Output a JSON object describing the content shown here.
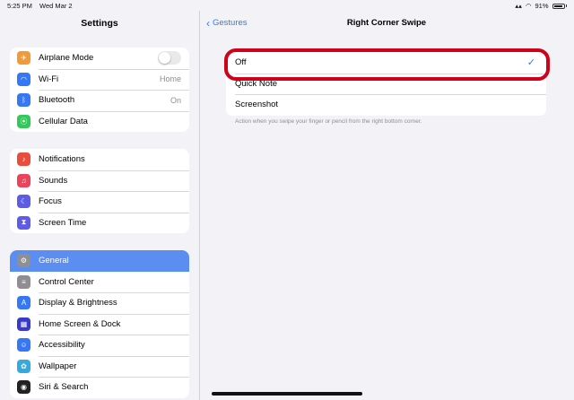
{
  "status": {
    "time": "5:25 PM",
    "date": "Wed Mar 2",
    "battery": "91%"
  },
  "sidebar": {
    "title": "Settings",
    "groups": [
      [
        {
          "label": "Airplane Mode",
          "icon": "airplane-icon",
          "color": "#f19a37",
          "value": "",
          "toggle": true
        },
        {
          "label": "Wi-Fi",
          "icon": "wifi-icon",
          "color": "#3478f6",
          "value": "Home"
        },
        {
          "label": "Bluetooth",
          "icon": "bluetooth-icon",
          "color": "#3478f6",
          "value": "On"
        },
        {
          "label": "Cellular Data",
          "icon": "cellular-icon",
          "color": "#34c759",
          "value": ""
        }
      ],
      [
        {
          "label": "Notifications",
          "icon": "bell-icon",
          "color": "#eb4d3d",
          "value": ""
        },
        {
          "label": "Sounds",
          "icon": "speaker-icon",
          "color": "#eb445a",
          "value": ""
        },
        {
          "label": "Focus",
          "icon": "moon-icon",
          "color": "#5e5ce6",
          "value": ""
        },
        {
          "label": "Screen Time",
          "icon": "hourglass-icon",
          "color": "#5e5ce6",
          "value": ""
        }
      ],
      [
        {
          "label": "General",
          "icon": "gear-icon",
          "color": "#8e8e93",
          "value": "",
          "selected": true
        },
        {
          "label": "Control Center",
          "icon": "sliders-icon",
          "color": "#8e8e93",
          "value": ""
        },
        {
          "label": "Display & Brightness",
          "icon": "text-size-icon",
          "color": "#3478f6",
          "value": ""
        },
        {
          "label": "Home Screen & Dock",
          "icon": "grid-icon",
          "color": "#3a3ac8",
          "value": ""
        },
        {
          "label": "Accessibility",
          "icon": "accessibility-icon",
          "color": "#3478f6",
          "value": ""
        },
        {
          "label": "Wallpaper",
          "icon": "flower-icon",
          "color": "#35aadc",
          "value": ""
        },
        {
          "label": "Siri & Search",
          "icon": "siri-icon",
          "color": "#222",
          "value": ""
        }
      ]
    ]
  },
  "detail": {
    "back_label": "Gestures",
    "title": "Right Corner Swipe",
    "options": [
      {
        "label": "Off",
        "checked": true
      },
      {
        "label": "Quick Note",
        "checked": false
      },
      {
        "label": "Screenshot",
        "checked": false
      }
    ],
    "footer": "Action when you swipe your finger or pencil from the right bottom corner."
  }
}
